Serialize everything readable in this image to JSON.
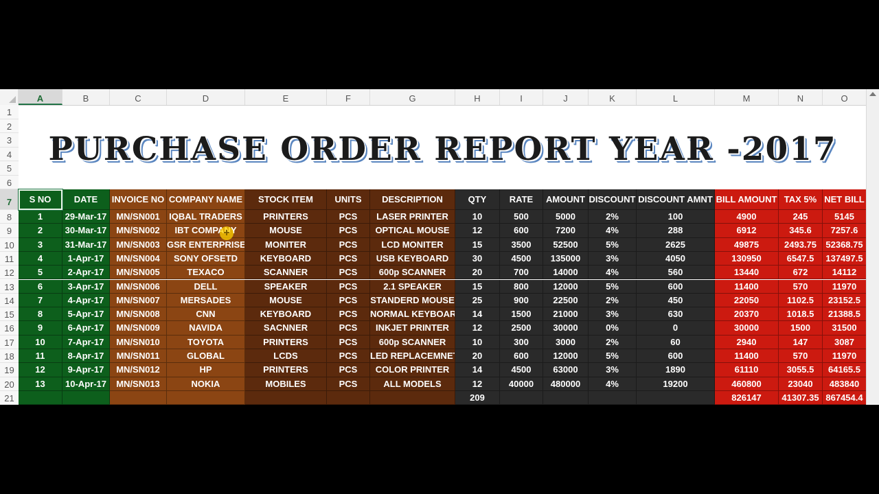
{
  "column_letters": [
    "A",
    "B",
    "C",
    "D",
    "E",
    "F",
    "G",
    "H",
    "I",
    "J",
    "K",
    "L",
    "M",
    "N",
    "O"
  ],
  "selected_column": "A",
  "row_numbers": [
    "1",
    "2",
    "3",
    "4",
    "5",
    "6",
    "7",
    "8",
    "9",
    "10",
    "11",
    "12",
    "13",
    "14",
    "15",
    "16",
    "17",
    "18",
    "19",
    "20",
    "21"
  ],
  "selected_row": "7",
  "title": "PURCHASE ORDER REPORT YEAR -2017",
  "colors": {
    "green": "#0d5f1c",
    "orange_brown": "#8b4513",
    "dark_brown": "#5c2a0d",
    "dark_gray": "#2a2a2a",
    "red": "#cc1a10"
  },
  "table": {
    "headers": [
      "S NO",
      "DATE",
      "INVOICE NO",
      "COMPANY NAME",
      "STOCK ITEM",
      "UNITS",
      "DESCRIPTION",
      "QTY",
      "RATE",
      "AMOUNT",
      "DISCOUNT",
      "DISCOUNT AMNT",
      "BILL AMOUNT",
      "TAX 5%",
      "NET BILL"
    ],
    "rows": [
      [
        "1",
        "29-Mar-17",
        "MN/SN001",
        "IQBAL TRADERS",
        "PRINTERS",
        "PCS",
        "LASER PRINTER",
        "10",
        "500",
        "5000",
        "2%",
        "100",
        "4900",
        "245",
        "5145"
      ],
      [
        "2",
        "30-Mar-17",
        "MN/SN002",
        "IBT COMPANY",
        "MOUSE",
        "PCS",
        "OPTICAL MOUSE",
        "12",
        "600",
        "7200",
        "4%",
        "288",
        "6912",
        "345.6",
        "7257.6"
      ],
      [
        "3",
        "31-Mar-17",
        "MN/SN003",
        "GSR ENTERPRISES",
        "MONITER",
        "PCS",
        "LCD MONITER",
        "15",
        "3500",
        "52500",
        "5%",
        "2625",
        "49875",
        "2493.75",
        "52368.75"
      ],
      [
        "4",
        "1-Apr-17",
        "MN/SN004",
        "SONY OFSETD",
        "KEYBOARD",
        "PCS",
        "USB KEYBOARD",
        "30",
        "4500",
        "135000",
        "3%",
        "4050",
        "130950",
        "6547.5",
        "137497.5"
      ],
      [
        "5",
        "2-Apr-17",
        "MN/SN005",
        "TEXACO",
        "SCANNER",
        "PCS",
        "600p SCANNER",
        "20",
        "700",
        "14000",
        "4%",
        "560",
        "13440",
        "672",
        "14112"
      ],
      [
        "6",
        "3-Apr-17",
        "MN/SN006",
        "DELL",
        "SPEAKER",
        "PCS",
        "2.1 SPEAKER",
        "15",
        "800",
        "12000",
        "5%",
        "600",
        "11400",
        "570",
        "11970"
      ],
      [
        "7",
        "4-Apr-17",
        "MN/SN007",
        "MERSADES",
        "MOUSE",
        "PCS",
        "STANDERD MOUSE",
        "25",
        "900",
        "22500",
        "2%",
        "450",
        "22050",
        "1102.5",
        "23152.5"
      ],
      [
        "8",
        "5-Apr-17",
        "MN/SN008",
        "CNN",
        "KEYBOARD",
        "PCS",
        "NORMAL KEYBOARD",
        "14",
        "1500",
        "21000",
        "3%",
        "630",
        "20370",
        "1018.5",
        "21388.5"
      ],
      [
        "9",
        "6-Apr-17",
        "MN/SN009",
        "NAVIDA",
        "SACNNER",
        "PCS",
        "INKJET PRINTER",
        "12",
        "2500",
        "30000",
        "0%",
        "0",
        "30000",
        "1500",
        "31500"
      ],
      [
        "10",
        "7-Apr-17",
        "MN/SN010",
        "TOYOTA",
        "PRINTERS",
        "PCS",
        "600p SCANNER",
        "10",
        "300",
        "3000",
        "2%",
        "60",
        "2940",
        "147",
        "3087"
      ],
      [
        "11",
        "8-Apr-17",
        "MN/SN011",
        "GLOBAL",
        "LCDS",
        "PCS",
        "LED REPLACEMNET",
        "20",
        "600",
        "12000",
        "5%",
        "600",
        "11400",
        "570",
        "11970"
      ],
      [
        "12",
        "9-Apr-17",
        "MN/SN012",
        "HP",
        "PRINTERS",
        "PCS",
        "COLOR PRINTER",
        "14",
        "4500",
        "63000",
        "3%",
        "1890",
        "61110",
        "3055.5",
        "64165.5"
      ],
      [
        "13",
        "10-Apr-17",
        "MN/SN013",
        "NOKIA",
        "MOBILES",
        "PCS",
        "ALL MODELS",
        "12",
        "40000",
        "480000",
        "4%",
        "19200",
        "460800",
        "23040",
        "483840"
      ]
    ],
    "totals": [
      "",
      "",
      "",
      "",
      "",
      "",
      "",
      "209",
      "",
      "",
      "",
      "",
      "826147",
      "41307.35",
      "867454.4"
    ]
  }
}
